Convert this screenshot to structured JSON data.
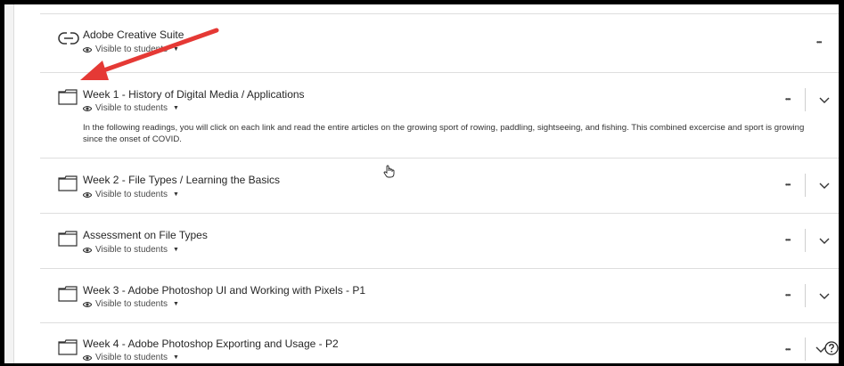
{
  "items": [
    {
      "title": "Adobe Creative Suite",
      "visibility": "Visible to students",
      "type": "link",
      "icon": "link-icon"
    },
    {
      "title": "Week 1 - History of Digital Media / Applications",
      "visibility": "Visible to students",
      "type": "folder",
      "icon": "folder-icon",
      "description": "In the following readings, you will click on each link and read the entire articles on the growing sport of rowing, paddling, sightseeing, and fishing. This combined excercise and sport is growing since the onset of COVID."
    },
    {
      "title": "Week 2 - File Types / Learning the Basics",
      "visibility": "Visible to students",
      "type": "folder",
      "icon": "folder-icon"
    },
    {
      "title": "Assessment on File Types",
      "visibility": "Visible to students",
      "type": "folder",
      "icon": "folder-icon"
    },
    {
      "title": "Week 3 - Adobe Photoshop UI and Working with Pixels - P1",
      "visibility": "Visible to students",
      "type": "folder",
      "icon": "folder-icon"
    },
    {
      "title": "Week 4 - Adobe Photoshop Exporting and Usage - P2",
      "visibility": "Visible to students",
      "type": "folder",
      "icon": "folder-icon"
    }
  ],
  "more_label": "•••",
  "colors": {
    "annotation_arrow": "#e53935",
    "text": "#262626",
    "separator": "#dedede"
  },
  "icons": [
    "link-icon",
    "folder-icon",
    "eye-icon",
    "caret-down-icon",
    "more-options-icon",
    "chevron-down-icon",
    "help-icon",
    "hand-cursor-icon",
    "annotation-arrow"
  ]
}
